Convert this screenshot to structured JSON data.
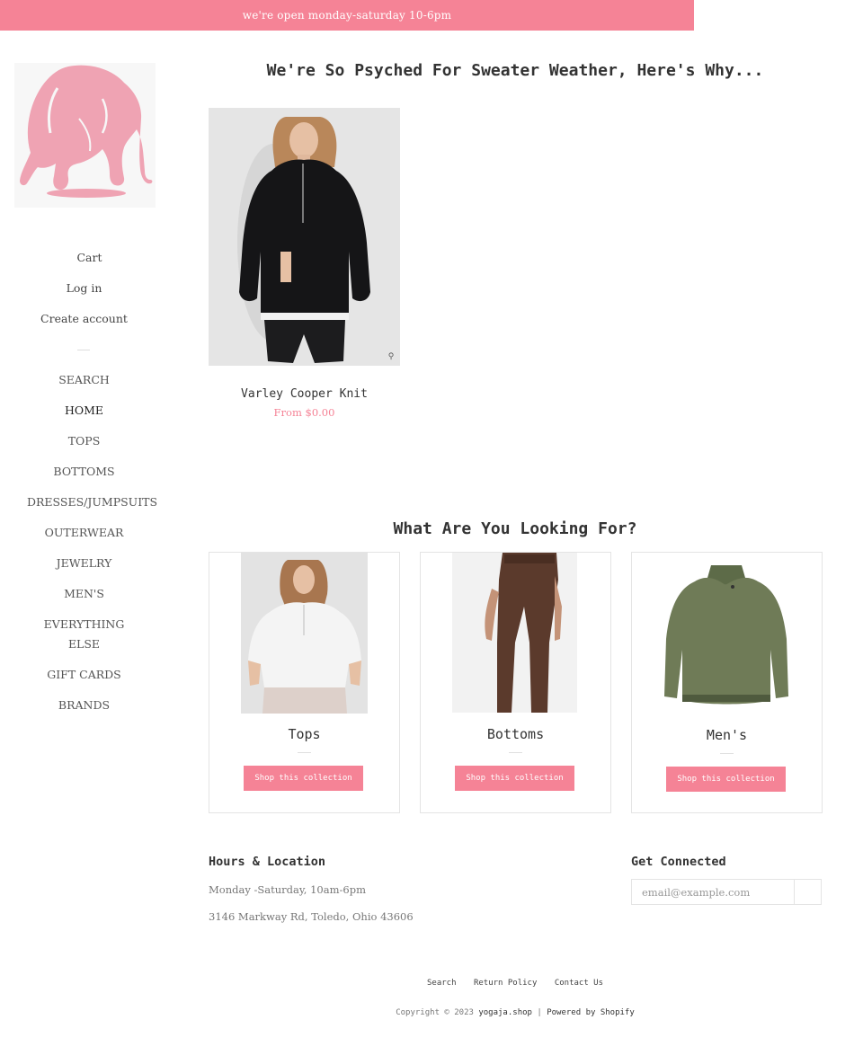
{
  "announcement": {
    "text": "we're open monday-saturday 10-6pm"
  },
  "logo": {
    "name": "elephant-logo"
  },
  "sidebar": {
    "account_links": [
      "Cart",
      "Log in",
      "Create account"
    ],
    "nav_items": [
      "SEARCH",
      "HOME",
      "TOPS",
      "BOTTOMS",
      "DRESSES/JUMPSUITS",
      "OUTERWEAR",
      "JEWELRY",
      "MEN'S",
      "EVERYTHING ELSE",
      "GIFT CARDS",
      "BRANDS"
    ],
    "active_item": "HOME"
  },
  "featured": {
    "title": "We're So Psyched For Sweater Weather, Here's Why...",
    "product": {
      "name": "Varley Cooper Knit",
      "price": "From $0.00"
    }
  },
  "collections": {
    "title": "What Are You Looking For?",
    "items": [
      {
        "name": "Tops",
        "button": "Shop this collection"
      },
      {
        "name": "Bottoms",
        "button": "Shop this collection"
      },
      {
        "name": "Men's",
        "button": "Shop this collection"
      }
    ]
  },
  "footer": {
    "hours_heading": "Hours & Location",
    "hours": "Monday -Saturday, 10am-6pm",
    "address": "3146 Markway Rd, Toledo, Ohio 43606",
    "connect_heading": "Get Connected",
    "email_placeholder": "email@example.com",
    "links": [
      "Search",
      "Return Policy",
      "Contact Us"
    ],
    "copyright_prefix": "Copyright © 2023",
    "site_name": "yogaja.shop",
    "separator": "|",
    "powered_by": "Powered by Shopify"
  },
  "colors": {
    "accent": "#f58396",
    "text": "#333333",
    "border": "#e4e4e4"
  }
}
